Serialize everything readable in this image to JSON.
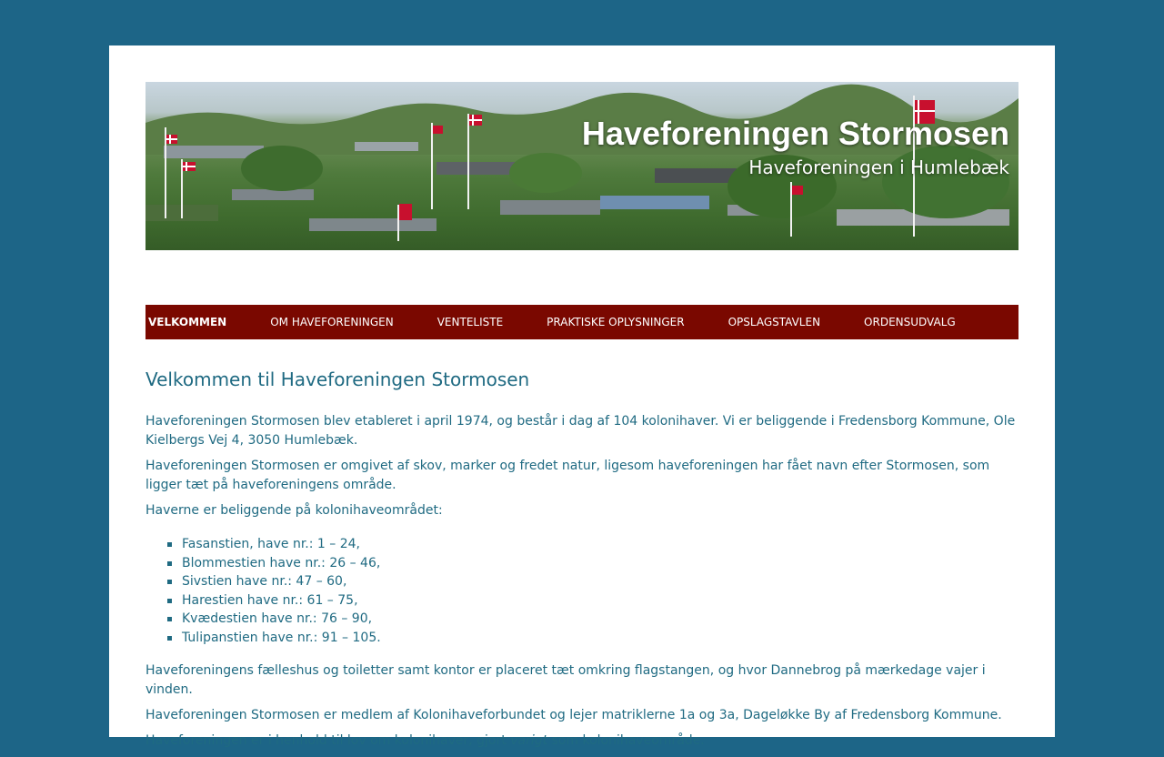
{
  "header": {
    "site_title": "Haveforeningen Stormosen",
    "site_description": "Haveforeningen i Humlebæk"
  },
  "nav": {
    "items": [
      {
        "label": "VELKOMMEN"
      },
      {
        "label": "OM HAVEFORENINGEN"
      },
      {
        "label": "VENTELISTE"
      },
      {
        "label": "PRAKTISKE OPLYSNINGER"
      },
      {
        "label": "OPSLAGSTAVLEN"
      },
      {
        "label": "ORDENSUDVALG"
      }
    ]
  },
  "main": {
    "title": "Velkommen til Haveforeningen Stormosen",
    "paragraphs": [
      "Haveforeningen Stormosen blev etableret i april 1974, og består i dag af 104 kolonihaver. Vi er beliggende i Fredensborg Kommune, Ole Kielbergs Vej 4, 3050 Humlebæk.",
      "Haveforeningen Stormosen er omgivet af skov, marker og fredet natur, ligesom haveforeningen har fået navn efter Stormosen, som ligger tæt på haveforeningens område.",
      "Haverne er beliggende på kolonihaveområdet:"
    ],
    "list": [
      "Fasanstien, have nr.: 1 – 24,",
      "Blommestien have nr.: 26 – 46,",
      "Sivstien have nr.: 47 – 60,",
      "Harestien have nr.: 61 – 75,",
      "Kvædestien have nr.: 76 – 90,",
      "Tulipanstien have nr.: 91 – 105."
    ],
    "after": [
      "Haveforeningens fælleshus og toiletter samt kontor er placeret tæt omkring flagstangen, og hvor Dannebrog på mærkedage vajer i vinden.",
      "Haveforeningen Stormosen er medlem af Kolonihaveforbundet og lejer matriklerne 1a og 3a, Dageløkke By af Fredensborg Kommune."
    ],
    "last_paragraph": {
      "before": "Haveforeningen er i henhold til lov om kolonihaver, gjort ",
      "emphasis": "varigt",
      "after": " som kolonihaveområde."
    }
  },
  "colors": {
    "background": "#1d6587",
    "nav": "#7a0800",
    "text": "#1f6a82"
  }
}
